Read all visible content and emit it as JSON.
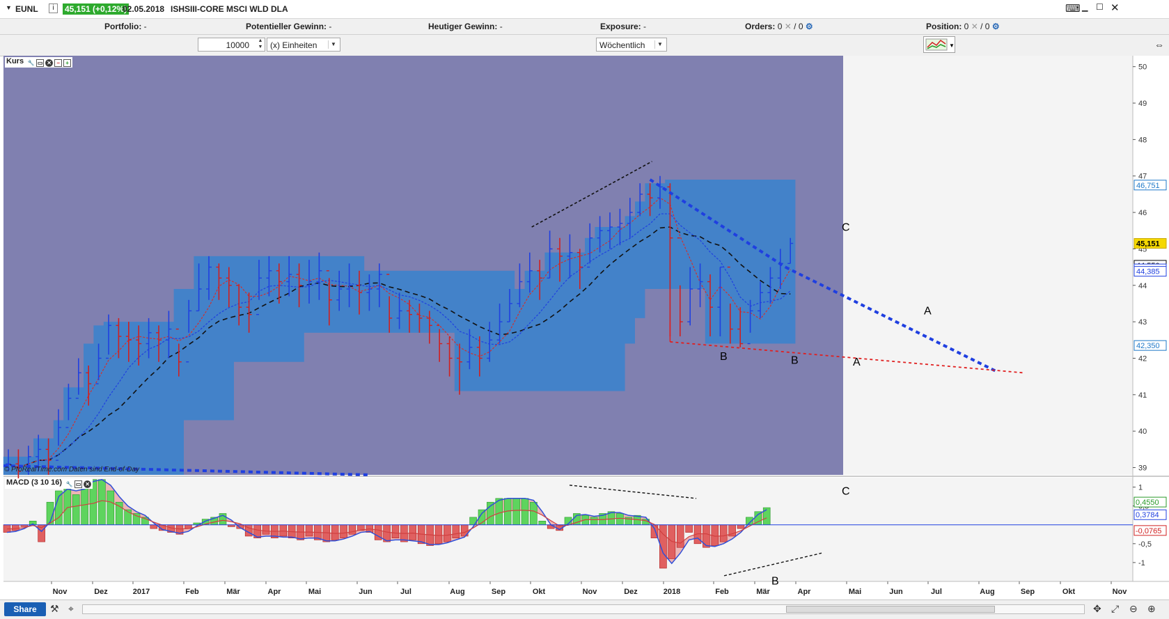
{
  "header": {
    "symbol": "EUNL",
    "info_icon": "info-icon",
    "price_badge": "45,151 (+0,12%)",
    "date": "02.05.2018",
    "instrument": "ISHSIII-CORE MSCI WLD DLA"
  },
  "infobar": {
    "portfolio_label": "Portfolio:",
    "portfolio_value": "-",
    "pot_gain_label": "Potentieller Gewinn:",
    "pot_gain_value": "-",
    "today_gain_label": "Heutiger Gewinn:",
    "today_gain_value": "-",
    "exposure_label": "Exposure:",
    "exposure_value": "-",
    "orders_label": "Orders:",
    "orders_value": "0",
    "orders_value2": "0",
    "position_label": "Position:",
    "position_value": "0",
    "position_value2": "0"
  },
  "controls": {
    "quantity": "10000",
    "unit_select": "(x) Einheiten",
    "period_select": "Wöchentlich"
  },
  "panels": {
    "price_label": "Kurs",
    "macd_label": "MACD (3 10 16)",
    "copyright": "© ProRealTime.com  Daten sind End-of-Day"
  },
  "footer": {
    "share_label": "Share"
  },
  "colors": {
    "bg_purple": "#8080b0",
    "band_blue": "#3c82cc",
    "candle_up": "#1f40e0",
    "candle_down": "#d02020",
    "macd_pos": "#5ed45e",
    "macd_neg": "#e06060",
    "trend_blue": "#1f3fe0",
    "trend_red": "#e02020"
  },
  "chart_data": [
    {
      "type": "bar",
      "subtype": "ohlc-weekly",
      "title": "EUNL",
      "ylim": [
        38.8,
        50.3
      ],
      "y_ticks": [
        "50",
        "49",
        "48",
        "47",
        "46",
        "45",
        "44",
        "43",
        "42",
        "41",
        "40",
        "39"
      ],
      "x_month_labels": [
        "Nov",
        "Dez",
        "2017",
        "Feb",
        "Mär",
        "Apr",
        "Mai",
        "Jun",
        "Jul",
        "Aug",
        "Sep",
        "Okt",
        "Nov",
        "Dez",
        "2018",
        "Feb",
        "Mär",
        "Apr",
        "Mai",
        "Jun",
        "Jul",
        "Aug",
        "Sep",
        "Okt",
        "Nov"
      ],
      "price_tags": [
        {
          "label": "46,751",
          "value": 46.751,
          "color": "#1e78c8"
        },
        {
          "label": "45,151",
          "value": 45.151,
          "color": "#000000",
          "bg": "#f5d800"
        },
        {
          "label": "44,550",
          "value": 44.55,
          "color": "#000000"
        },
        {
          "label": "44,451",
          "value": 44.451,
          "color": "#1f3fe0"
        },
        {
          "label": "44,385",
          "value": 44.385,
          "color": "#1f3fe0"
        },
        {
          "label": "42,350",
          "value": 42.35,
          "color": "#1e78c8"
        }
      ],
      "closes": [
        39.1,
        38.9,
        39.3,
        39.5,
        39.2,
        40.1,
        40.9,
        41.6,
        41.3,
        42.0,
        42.9,
        42.6,
        42.5,
        42.4,
        42.7,
        42.5,
        42.8,
        41.9,
        43.3,
        43.9,
        44.5,
        44.2,
        44.0,
        43.4,
        43.2,
        44.2,
        44.4,
        44.1,
        44.3,
        44.0,
        44.1,
        44.4,
        43.6,
        43.9,
        44.0,
        43.8,
        43.9,
        44.3,
        43.1,
        43.3,
        43.2,
        43.1,
        42.9,
        42.4,
        42.0,
        41.9,
        42.3,
        42.0,
        42.5,
        43.0,
        43.5,
        44.1,
        44.4,
        44.2,
        45.0,
        44.8,
        44.9,
        44.5,
        45.3,
        45.5,
        45.6,
        45.7,
        46.0,
        46.5,
        46.4,
        46.7,
        45.3,
        43.0,
        43.9,
        44.1,
        43.4,
        44.5,
        42.8,
        42.4,
        43.3,
        43.8,
        44.2,
        44.6,
        45.151
      ],
      "lows": [
        38.9,
        38.6,
        38.8,
        38.9,
        38.8,
        39.6,
        40.3,
        41.0,
        40.7,
        41.4,
        42.1,
        42.0,
        41.9,
        41.8,
        42.0,
        41.9,
        42.0,
        41.5,
        42.7,
        43.3,
        43.6,
        43.6,
        43.4,
        42.9,
        42.7,
        43.6,
        43.7,
        43.5,
        43.7,
        43.4,
        43.5,
        43.6,
        42.9,
        43.3,
        43.4,
        43.2,
        43.3,
        43.4,
        42.7,
        42.8,
        42.7,
        42.7,
        42.4,
        41.9,
        41.5,
        41.0,
        41.7,
        41.5,
        41.9,
        42.4,
        43.0,
        43.4,
        43.8,
        43.6,
        44.2,
        44.1,
        44.2,
        43.9,
        44.6,
        44.9,
        45.0,
        45.1,
        45.3,
        45.9,
        45.9,
        46.1,
        42.6,
        42.6,
        42.9,
        43.4,
        42.6,
        42.6,
        42.4,
        42.3,
        42.7,
        43.1,
        43.5,
        43.9,
        44.6
      ],
      "highs": [
        39.5,
        39.5,
        39.6,
        39.9,
        39.8,
        40.6,
        41.3,
        42.0,
        41.8,
        42.4,
        43.2,
        43.1,
        43.0,
        42.9,
        43.1,
        42.9,
        43.3,
        42.4,
        43.6,
        44.6,
        44.8,
        44.6,
        44.5,
        44.0,
        43.8,
        44.7,
        44.8,
        44.6,
        44.8,
        44.6,
        44.7,
        44.9,
        44.2,
        44.4,
        44.6,
        44.4,
        44.3,
        44.6,
        43.7,
        43.8,
        43.6,
        43.5,
        43.3,
        42.8,
        42.6,
        42.4,
        42.8,
        42.6,
        43.0,
        43.5,
        43.9,
        44.6,
        44.9,
        44.7,
        45.5,
        45.3,
        45.4,
        45.0,
        45.7,
        45.9,
        46.0,
        46.1,
        46.4,
        46.8,
        46.8,
        47.0,
        46.8,
        44.0,
        44.5,
        44.6,
        44.3,
        44.5,
        43.5,
        43.4,
        43.6,
        44.1,
        44.5,
        45.0,
        45.3
      ],
      "band_upper": [
        39.3,
        39.3,
        39.3,
        39.8,
        39.8,
        40.3,
        41.2,
        41.2,
        42.4,
        42.9,
        43.0,
        43.0,
        43.0,
        43.0,
        43.0,
        43.0,
        43.0,
        43.9,
        43.9,
        44.8,
        44.8,
        44.8,
        44.8,
        44.8,
        44.8,
        44.8,
        44.8,
        44.8,
        44.8,
        44.8,
        44.8,
        44.8,
        44.8,
        44.8,
        44.8,
        44.8,
        44.4,
        44.4,
        44.4,
        44.4,
        44.4,
        44.4,
        44.4,
        44.4,
        44.4,
        44.4,
        44.4,
        44.4,
        44.4,
        44.4,
        44.4,
        43.9,
        44.4,
        44.4,
        44.9,
        44.9,
        44.9,
        44.9,
        45.3,
        45.6,
        45.6,
        45.6,
        45.9,
        46.3,
        46.8,
        46.8,
        46.9,
        46.9,
        46.9,
        46.9,
        46.9,
        46.9,
        46.9,
        46.9,
        46.9,
        46.9,
        46.9,
        46.9,
        46.9
      ],
      "band_lower": [
        38.8,
        38.8,
        38.8,
        38.8,
        38.8,
        38.8,
        38.8,
        38.8,
        38.8,
        38.8,
        38.8,
        38.8,
        38.8,
        38.8,
        38.8,
        38.8,
        38.8,
        38.8,
        40.3,
        40.3,
        40.3,
        40.3,
        40.3,
        41.9,
        41.9,
        41.9,
        41.9,
        41.9,
        41.9,
        41.9,
        42.7,
        42.7,
        42.7,
        42.7,
        42.7,
        42.7,
        42.7,
        42.7,
        42.7,
        42.7,
        42.7,
        42.7,
        42.7,
        42.7,
        42.7,
        41.1,
        41.1,
        41.1,
        41.1,
        41.1,
        41.1,
        41.1,
        41.1,
        41.1,
        41.1,
        41.1,
        41.1,
        41.1,
        41.1,
        41.1,
        41.1,
        41.1,
        42.4,
        43.1,
        43.9,
        43.9,
        43.9,
        43.9,
        43.9,
        43.9,
        42.4,
        42.4,
        42.4,
        42.4,
        42.4,
        42.4,
        42.4,
        42.4,
        42.4
      ]
    },
    {
      "type": "bar",
      "subtype": "macd-histogram",
      "title": "MACD (3 10 16)",
      "ylim": [
        -1.5,
        1.25
      ],
      "y_ticks": [
        "1",
        "0,5",
        "-0,5",
        "-1"
      ],
      "value_tags": [
        {
          "label": "0,4550",
          "value": 0.455,
          "color": "#2a9a2a"
        },
        {
          "label": "0,3784",
          "value": 0.3784,
          "color": "#1f3fe0"
        },
        {
          "label": "-0,0765",
          "value": -0.0765,
          "color": "#d02020"
        }
      ],
      "histogram": [
        -0.2,
        -0.15,
        -0.05,
        0.1,
        -0.45,
        0.6,
        0.9,
        1.0,
        0.8,
        1.1,
        1.2,
        1.2,
        0.9,
        0.6,
        0.4,
        0.3,
        0.2,
        -0.1,
        -0.15,
        -0.2,
        -0.25,
        -0.1,
        0.05,
        0.15,
        0.2,
        0.3,
        -0.05,
        -0.1,
        -0.3,
        -0.35,
        -0.25,
        -0.35,
        -0.3,
        -0.35,
        -0.4,
        -0.3,
        -0.4,
        -0.45,
        -0.4,
        -0.35,
        -0.25,
        -0.15,
        -0.2,
        -0.4,
        -0.45,
        -0.35,
        -0.45,
        -0.4,
        -0.5,
        -0.55,
        -0.5,
        -0.45,
        -0.35,
        -0.3,
        0.2,
        0.4,
        0.6,
        0.7,
        0.7,
        0.7,
        0.7,
        0.6,
        0.1,
        -0.1,
        -0.15,
        0.2,
        0.3,
        0.25,
        0.2,
        0.3,
        0.35,
        0.3,
        0.2,
        0.25,
        0.15,
        -0.35,
        -1.15,
        -0.9,
        -0.6,
        -0.2,
        -0.5,
        -0.6,
        -0.55,
        -0.45,
        -0.3,
        -0.1,
        0.2,
        0.35,
        0.455
      ],
      "annotations": [
        "B",
        "C"
      ]
    }
  ],
  "annotations": [
    "A",
    "A",
    "B",
    "B",
    "C"
  ]
}
